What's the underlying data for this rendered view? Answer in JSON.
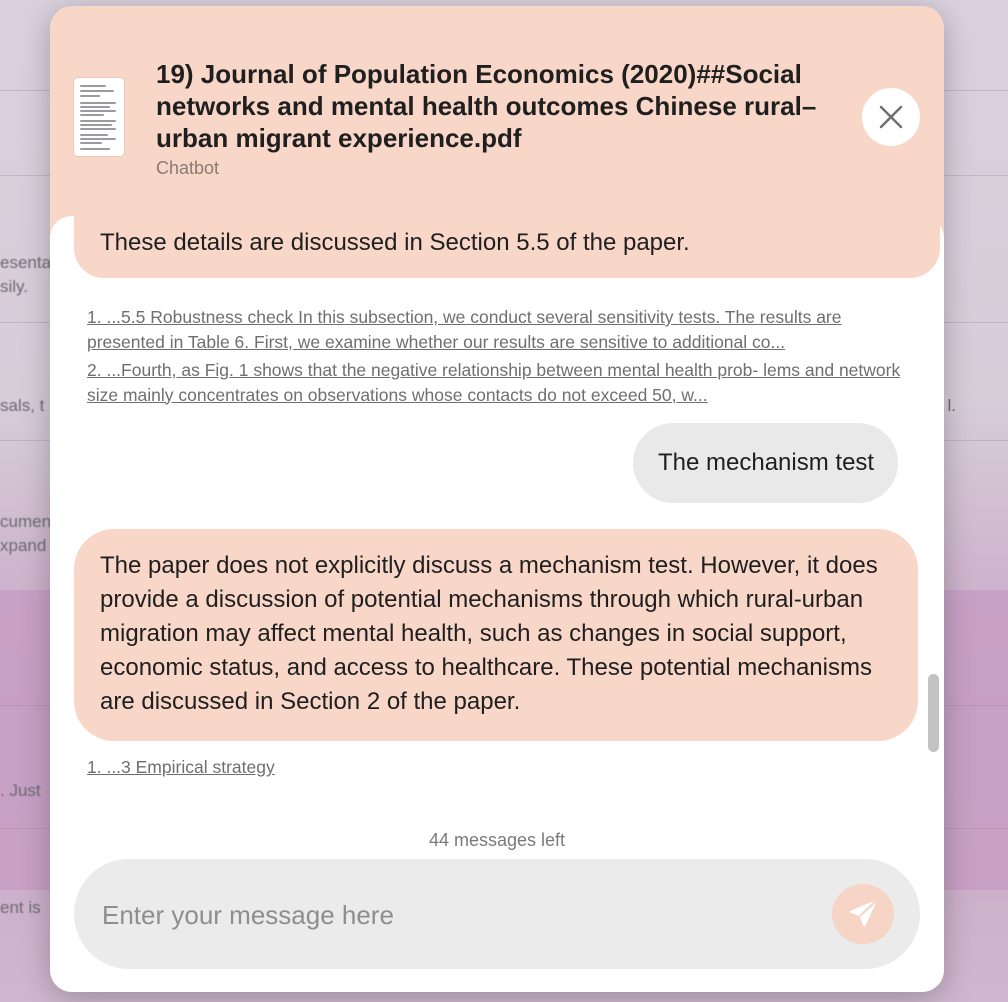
{
  "background": {
    "fragments": [
      "esenta",
      "sily.",
      "sals, t",
      "cumen",
      "xpand",
      ". Just",
      "ent is"
    ],
    "right_fragment": "l."
  },
  "modal": {
    "title": "19) Journal of Population Economics (2020)##Social networks and mental health outcomes Chinese rural–urban migrant experience.pdf",
    "subtitle": "Chatbot",
    "close_icon": "close-icon",
    "doc_icon": "document-thumbnail-icon"
  },
  "chat": {
    "messages": [
      {
        "role": "bot",
        "text": "These details are discussed in Section 5.5 of the paper.",
        "sources": [
          "1. ...5.5 Robustness check  In this subsection, we conduct several sensitivity tests. The results are presented in Table 6.  First, we examine whether our results are sensitive to additional co...",
          "2. ...Fourth, as Fig. 1 shows that the negative relationship between mental health prob- lems and network size mainly concentrates on observations whose contacts do not exceed 50, w..."
        ]
      },
      {
        "role": "user",
        "text": "The mechanism test"
      },
      {
        "role": "bot",
        "text": "The paper does not explicitly discuss a mechanism test. However, it does provide a discussion of potential mechanisms through which rural-urban migration may affect mental health, such as changes in social support, economic status, and access to healthcare. These potential mechanisms are discussed in Section 2 of the paper.",
        "sources": [
          "1. ...3 Empirical strategy"
        ]
      }
    ]
  },
  "footer": {
    "messages_left": "44 messages left",
    "input_placeholder": "Enter your message here",
    "input_value": "",
    "send_icon": "send-icon"
  },
  "colors": {
    "accent": "#f8d6c8",
    "user_bubble": "#e9e9e9",
    "input_bg": "#ebebeb"
  }
}
